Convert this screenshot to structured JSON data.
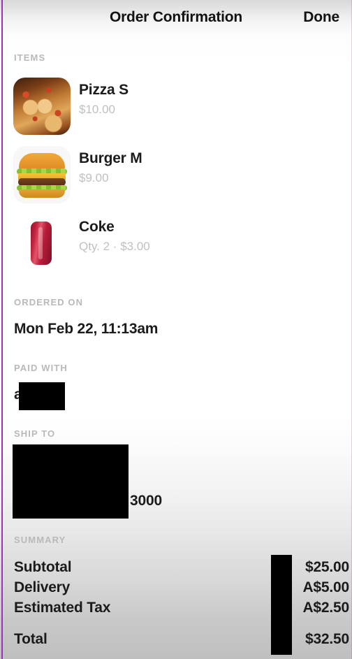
{
  "header": {
    "title": "Order Confirmation",
    "done_label": "Done"
  },
  "items_section": {
    "label": "ITEMS",
    "items": [
      {
        "name": "Pizza S",
        "detail": "$10.00",
        "thumbnail": "pizza-photo"
      },
      {
        "name": "Burger M",
        "detail": "$9.00",
        "thumbnail": "burger-photo"
      },
      {
        "name": "Coke",
        "detail": "Qty. 2 · $3.00",
        "thumbnail": "coke-can-photo"
      }
    ]
  },
  "ordered_on": {
    "label": "ORDERED ON",
    "value": "Mon Feb 22, 11:13am"
  },
  "paid_with": {
    "label": "PAID WITH",
    "value": "a",
    "redacted": true
  },
  "ship_to": {
    "label": "SHIP TO",
    "value": "",
    "suffix": "3000",
    "redacted": true
  },
  "summary": {
    "label": "SUMMARY",
    "rows": [
      {
        "key": "Subtotal",
        "value": "$25.00"
      },
      {
        "key": "Delivery",
        "value": "A$5.00"
      },
      {
        "key": "Estimated Tax",
        "value": "A$2.50"
      },
      {
        "key": "Total",
        "value": "$32.50"
      }
    ],
    "redacted": true
  },
  "colors": {
    "window_edge": "#9c32b8",
    "text_primary": "#1b1b1b",
    "text_muted": "#c0c0c0",
    "section_label": "#b9b9b9",
    "redaction": "#000000"
  }
}
